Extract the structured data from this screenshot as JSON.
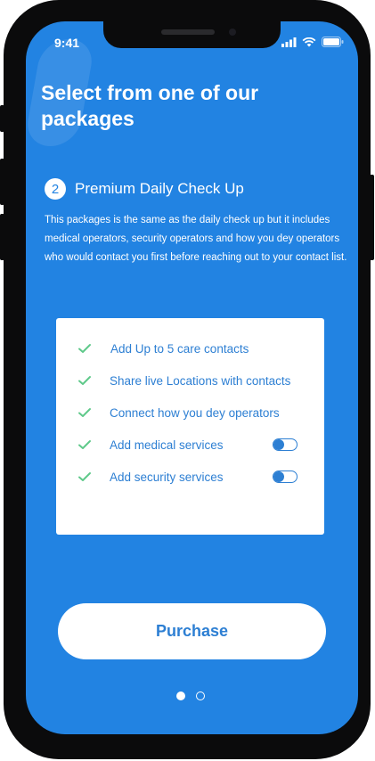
{
  "status_bar": {
    "time": "9:41",
    "icons": [
      "signal-icon",
      "wifi-icon",
      "battery-icon"
    ]
  },
  "headline": "Select from one of our packages",
  "package": {
    "step_number": "2",
    "title": "Premium Daily Check Up",
    "description": "This packages is the same as the daily check up but it includes medical operators, security operators and how you dey operators who would contact you first before reaching out to your contact list."
  },
  "features": [
    {
      "label": "Add Up to 5 care contacts",
      "icon": "check-icon"
    },
    {
      "label": "Share live Locations with contacts",
      "icon": "check-icon"
    },
    {
      "label": "Connect how you dey operators",
      "icon": "check-icon"
    },
    {
      "label": "Add medical services",
      "icon": "check-icon",
      "toggle": "on"
    },
    {
      "label": "Add security services",
      "icon": "check-icon",
      "toggle": "on"
    }
  ],
  "purchase_label": "Purchase",
  "pagination": {
    "pages": 2,
    "current": 1
  },
  "colors": {
    "background": "#2283e2",
    "accent": "#2d7fd3",
    "check": "#5fc98a",
    "card": "#ffffff"
  }
}
